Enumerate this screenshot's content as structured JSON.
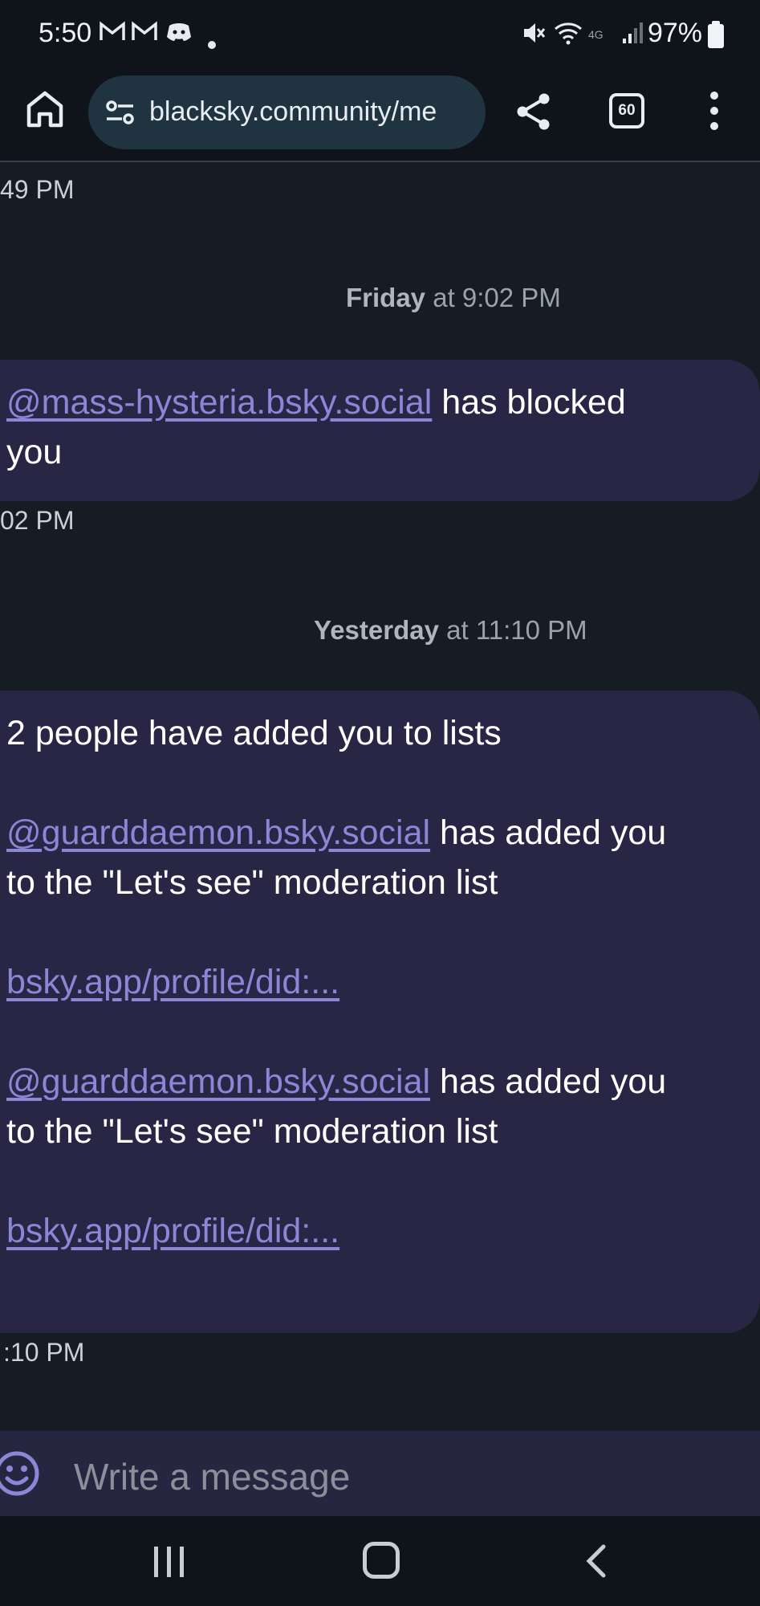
{
  "status_bar": {
    "time": "5:50",
    "battery": "97%",
    "icons": [
      "gmail-icon",
      "gmail-icon",
      "discord-icon",
      "dot-icon",
      "mute-icon",
      "wifi-icon",
      "lte-icon",
      "signal-icon",
      "battery-icon"
    ]
  },
  "browser": {
    "url": "blacksky.community/me",
    "tab_count": "60"
  },
  "chat": {
    "timestamp_top": "49 PM",
    "divider_1": {
      "day": "Friday",
      "time": "at 9:02 PM"
    },
    "message_1": {
      "handle": "@mass-hysteria.bsky.social",
      "text_a": "has blocked",
      "text_b": "you"
    },
    "timestamp_1": "02 PM",
    "divider_2": {
      "day": "Yesterday",
      "time": "at 11:10 PM"
    },
    "message_2": {
      "intro": "2 people have added you to lists",
      "entry_1": {
        "handle": "@guarddaemon.bsky.social",
        "text_a": "has added you",
        "text_b": "to the \"Let's see\" moderation list",
        "link": "bsky.app/profile/did:..."
      },
      "entry_2": {
        "handle": "@guarddaemon.bsky.social",
        "text_a": "has added you",
        "text_b": "to the \"Let's see\" moderation list",
        "link": "bsky.app/profile/did:..."
      }
    },
    "timestamp_2": ":10 PM"
  },
  "composer": {
    "placeholder": "Write a message"
  },
  "colors": {
    "background": "#161c24",
    "bubble": "#282644",
    "link": "#8b86d6",
    "composer": "#262640"
  }
}
